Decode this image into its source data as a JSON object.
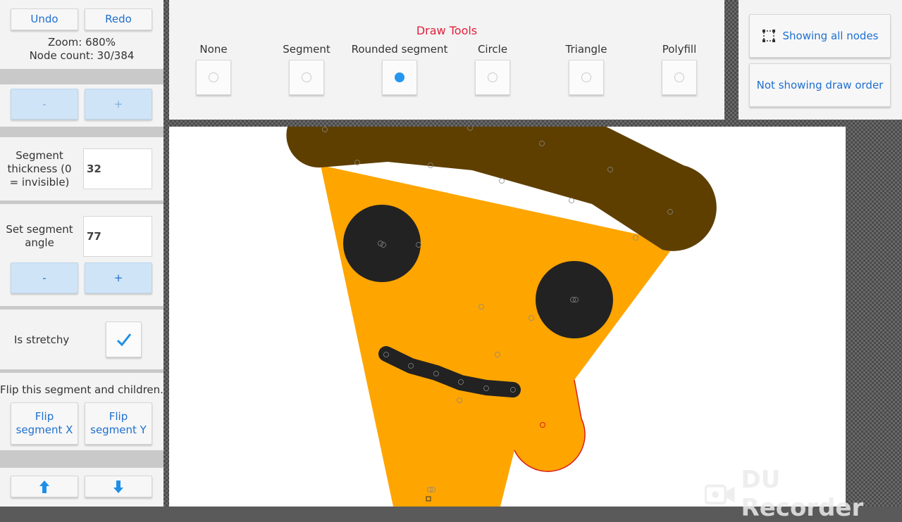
{
  "history": {
    "undo_label": "Undo",
    "redo_label": "Redo"
  },
  "status": {
    "zoom": "Zoom: 680%",
    "node_count": "Node count: 30/384"
  },
  "steppers": {
    "minus": "-",
    "plus": "+"
  },
  "segment_thickness": {
    "label": "Segment thickness (0 = invisible)",
    "value": "32"
  },
  "segment_angle": {
    "label": "Set segment angle",
    "value": "77"
  },
  "stretchy": {
    "label": "Is stretchy",
    "checked": true
  },
  "flip": {
    "heading": "Flip this segment and children.",
    "x_label": "Flip segment X",
    "y_label": "Flip segment Y"
  },
  "draw_tools": {
    "title": "Draw Tools",
    "title_color": "#e0203c",
    "tools": [
      {
        "label": "None",
        "selected": false
      },
      {
        "label": "Segment",
        "selected": false
      },
      {
        "label": "Rounded segment",
        "selected": true
      },
      {
        "label": "Circle",
        "selected": false
      },
      {
        "label": "Triangle",
        "selected": false
      },
      {
        "label": "Polyfill",
        "selected": false
      }
    ]
  },
  "view_options": {
    "nodes_label": "Showing all nodes",
    "order_label": "Not showing draw order"
  },
  "watermark": {
    "text": "DU Recorder"
  },
  "colors": {
    "accent": "#1e6fd0",
    "selected_radio": "#2496f0",
    "pizza": "#ffa500",
    "crust": "#5e3f00",
    "eyes": "#222222",
    "checker_dark": "#4a4a4a"
  }
}
